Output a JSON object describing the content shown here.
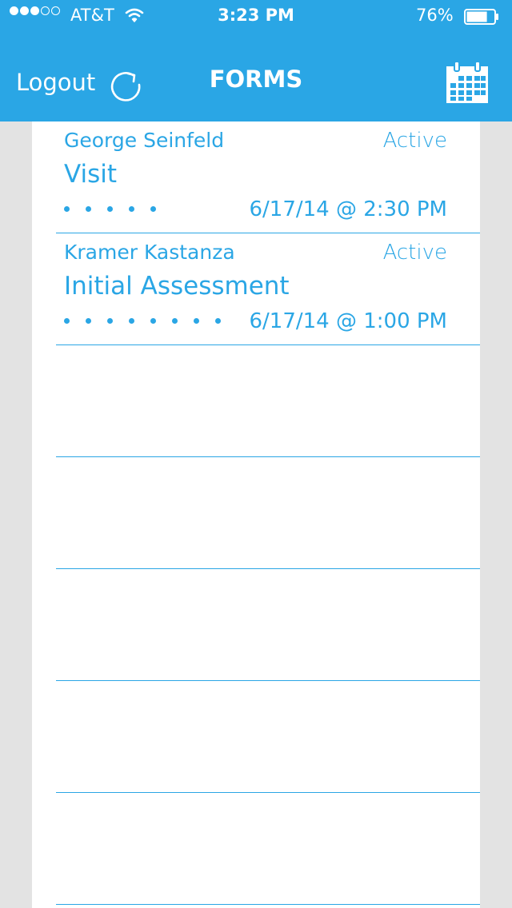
{
  "status_bar": {
    "carrier": "AT&T",
    "time": "3:23 PM",
    "battery": "76%",
    "battery_level": 0.76,
    "signal_bars_filled": 3,
    "signal_bars_total": 5
  },
  "nav": {
    "logout_label": "Logout",
    "title": "FORMS",
    "refresh_icon": "refresh-icon",
    "calendar_icon": "calendar-icon"
  },
  "forms": [
    {
      "name": "George Seinfeld",
      "status": "Active",
      "form": "Visit",
      "datetime": "6/17/14 @ 2:30 PM",
      "dots": 5
    },
    {
      "name": "Kramer Kastanza",
      "status": "Active",
      "form": "Initial Assessment",
      "datetime": "6/17/14 @ 1:00 PM",
      "dots": 8
    },
    {
      "name": "",
      "status": "",
      "form": "",
      "datetime": "",
      "dots": 0
    },
    {
      "name": "",
      "status": "",
      "form": "",
      "datetime": "",
      "dots": 0
    },
    {
      "name": "",
      "status": "",
      "form": "",
      "datetime": "",
      "dots": 0
    },
    {
      "name": "",
      "status": "",
      "form": "",
      "datetime": "",
      "dots": 0
    },
    {
      "name": "",
      "status": "",
      "form": "",
      "datetime": "",
      "dots": 0
    }
  ],
  "colors": {
    "accent": "#2aa6e5",
    "background": "#e3e3e3",
    "panel": "#ffffff"
  }
}
